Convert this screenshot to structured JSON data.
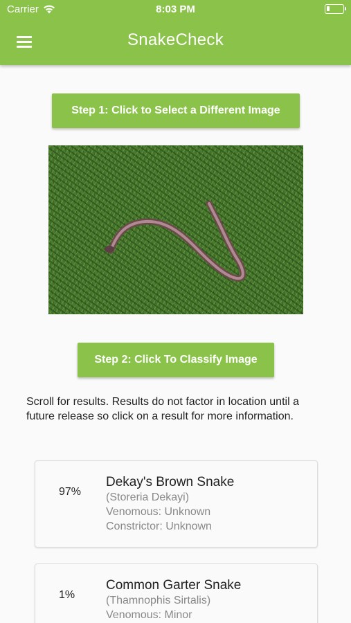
{
  "status_bar": {
    "carrier": "Carrier",
    "time": "8:03 PM",
    "battery_level": 0.1
  },
  "app_bar": {
    "title": "SnakeCheck",
    "menu_icon": "hamburger-menu-icon"
  },
  "step1_label": "Step 1: Click to Select a Different Image",
  "step2_label": "Step 2: Click To Classify Image",
  "info_text": "Scroll for results.  Results do not factor in location until a future release so click on a result for more information.",
  "results": [
    {
      "percent": "97%",
      "name": "Dekay's Brown Snake",
      "scientific": "(Storeria Dekayi)",
      "venomous": "Venomous: Unknown",
      "constrictor": "Constrictor: Unknown"
    },
    {
      "percent": "1%",
      "name": "Common Garter Snake",
      "scientific": "(Thamnophis Sirtalis)",
      "venomous": "Venomous: Minor",
      "constrictor": ""
    }
  ],
  "colors": {
    "accent": "#8bc34a",
    "background": "#fafafa"
  }
}
